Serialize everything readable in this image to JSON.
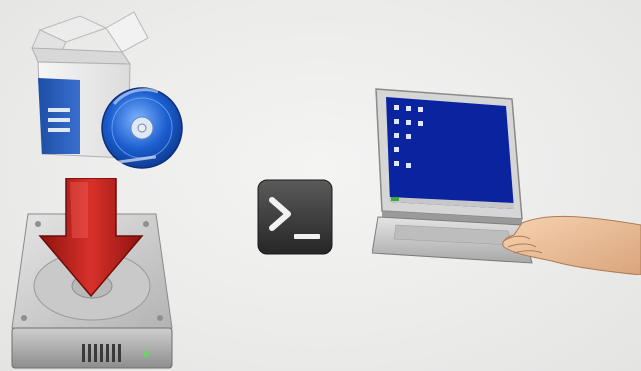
{
  "scene": {
    "items": [
      {
        "name": "software-package",
        "icon": "software-box-with-cd-icon"
      },
      {
        "name": "install-to-disk",
        "icon": "hard-disk-download-icon"
      },
      {
        "name": "terminal",
        "icon": "terminal-prompt-icon"
      },
      {
        "name": "computer",
        "icon": "laptop-with-hand-icon"
      }
    ],
    "colors": {
      "box_blue": "#1f4fa8",
      "cd_blue": "#1c5fd0",
      "arrow_red": "#c0201a",
      "terminal_dark": "#3a3a3a",
      "screen_blue": "#0a24a0"
    }
  }
}
